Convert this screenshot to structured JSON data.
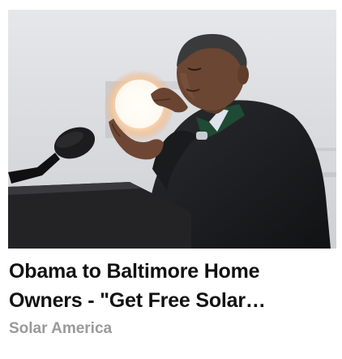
{
  "ad": {
    "title": "Obama to Baltimore Home Owners - \"Get Free Solar…",
    "source": "Solar America"
  }
}
